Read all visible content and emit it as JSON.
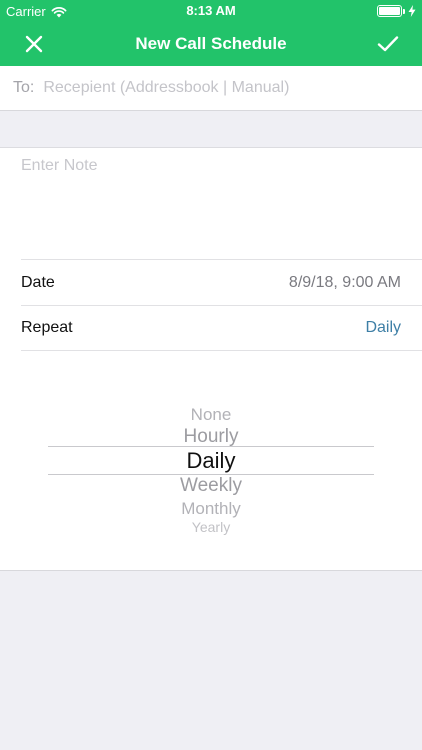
{
  "status_bar": {
    "carrier": "Carrier",
    "time": "8:13 AM",
    "icons": [
      "wifi-icon",
      "battery-icon",
      "charging-icon"
    ]
  },
  "nav": {
    "title": "New Call Schedule",
    "left_icon": "close-icon",
    "right_icon": "checkmark-icon",
    "color": "#22c36a"
  },
  "to_field": {
    "label": "To:",
    "placeholder": "Recepient (Addressbook | Manual)",
    "value": ""
  },
  "note": {
    "placeholder": "Enter Note",
    "value": ""
  },
  "date_row": {
    "label": "Date",
    "value": "8/9/18, 9:00 AM"
  },
  "repeat_row": {
    "label": "Repeat",
    "value": "Daily",
    "value_color": "#3e7fa6"
  },
  "picker": {
    "options": [
      "None",
      "Hourly",
      "Daily",
      "Weekly",
      "Monthly",
      "Yearly"
    ],
    "selected": "Daily"
  }
}
